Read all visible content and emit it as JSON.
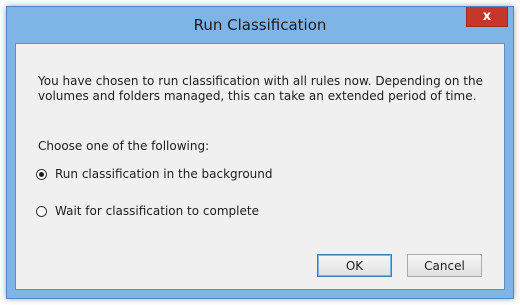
{
  "window": {
    "title": "Run Classification",
    "close_glyph": "x"
  },
  "dialog": {
    "description": "You have chosen to run classification with all rules now. Depending on the volumes and folders managed, this can take an extended period of time.",
    "prompt": "Choose one of the following:",
    "options": [
      {
        "label": "Run classification in the background",
        "checked": true
      },
      {
        "label": "Wait for classification to complete",
        "checked": false
      }
    ]
  },
  "buttons": {
    "ok": "OK",
    "cancel": "Cancel"
  },
  "colors": {
    "title_bar": "#7fb4e6",
    "close_button": "#c7362b",
    "client_bg": "#f0f0f0"
  }
}
